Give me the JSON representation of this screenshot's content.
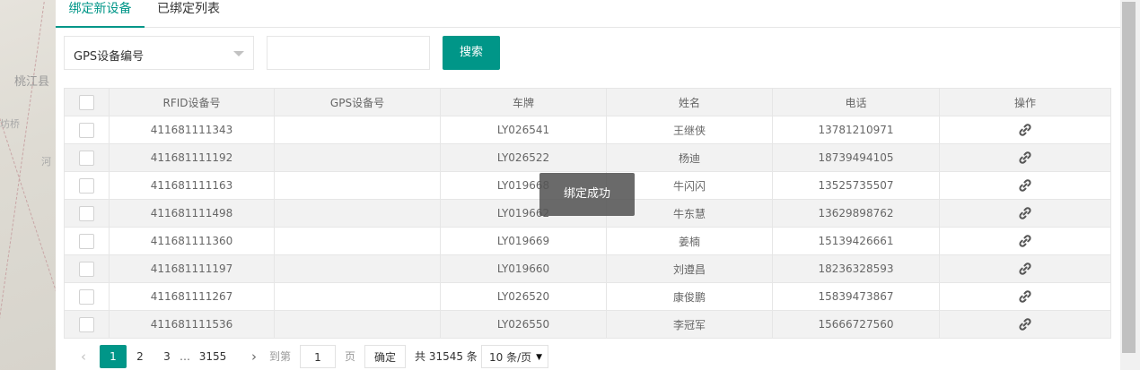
{
  "background_map": {
    "labels": [
      "桃江县",
      "坊桥",
      "河"
    ]
  },
  "tabs": [
    {
      "label": "绑定新设备",
      "active": true
    },
    {
      "label": "已绑定列表",
      "active": false
    }
  ],
  "search": {
    "field_select": "GPS设备编号",
    "input_value": "",
    "button_label": "搜索"
  },
  "table": {
    "columns": [
      "RFID设备号",
      "GPS设备号",
      "车牌",
      "姓名",
      "电话",
      "操作"
    ],
    "rows": [
      {
        "rfid": "411681111343",
        "gps": "",
        "plate": "LY026541",
        "name": "王继侠",
        "phone": "13781210971"
      },
      {
        "rfid": "411681111192",
        "gps": "",
        "plate": "LY026522",
        "name": "杨迪",
        "phone": "18739494105"
      },
      {
        "rfid": "411681111163",
        "gps": "",
        "plate": "LY019668",
        "name": "牛闪闪",
        "phone": "13525735507"
      },
      {
        "rfid": "411681111498",
        "gps": "",
        "plate": "LY019662",
        "name": "牛东慧",
        "phone": "13629898762"
      },
      {
        "rfid": "411681111360",
        "gps": "",
        "plate": "LY019669",
        "name": "姜楠",
        "phone": "15139426661"
      },
      {
        "rfid": "411681111197",
        "gps": "",
        "plate": "LY019660",
        "name": "刘遵昌",
        "phone": "18236328593"
      },
      {
        "rfid": "411681111267",
        "gps": "",
        "plate": "LY026520",
        "name": "康俊鹏",
        "phone": "15839473867"
      },
      {
        "rfid": "411681111536",
        "gps": "",
        "plate": "LY026550",
        "name": "李冠军",
        "phone": "15666727560"
      }
    ]
  },
  "toast": {
    "message": "绑定成功"
  },
  "pagination": {
    "pages": [
      "1",
      "2",
      "3"
    ],
    "ellipsis": "…",
    "last_page": "3155",
    "goto_label": "到第",
    "goto_value": "1",
    "page_unit": "页",
    "confirm_label": "确定",
    "total_text": "共 31545 条",
    "page_size": "10 条/页"
  },
  "colors": {
    "accent": "#009688",
    "header_bg": "#f2f2f2",
    "border": "#e6e6e6"
  },
  "icons": {
    "action": "link-icon",
    "prev": "chevron-left-icon",
    "next": "chevron-right-icon",
    "select_caret": "caret-down-icon"
  }
}
